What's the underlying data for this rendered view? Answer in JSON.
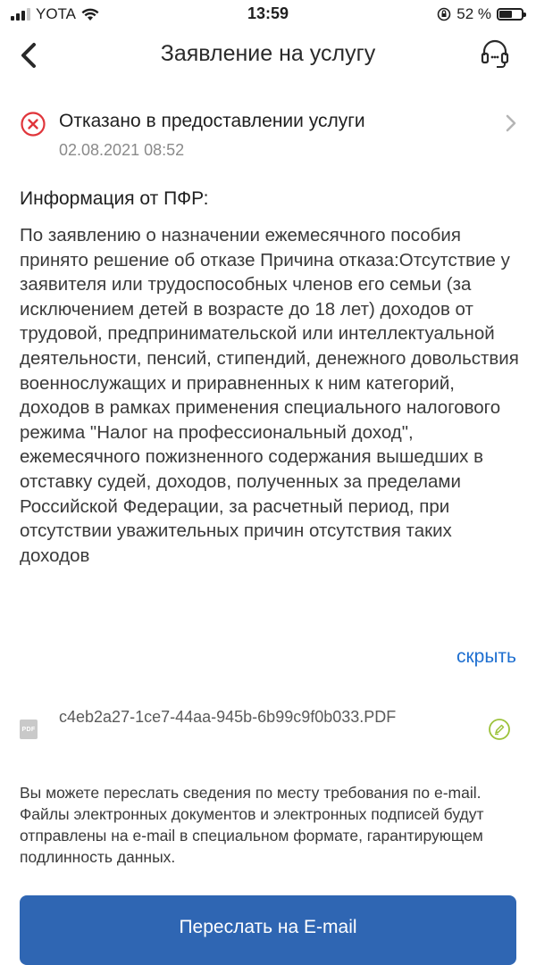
{
  "status_bar": {
    "carrier": "YOTA",
    "time": "13:59",
    "battery": "52 %",
    "battery_level": 0.52
  },
  "header": {
    "title": "Заявление на услугу",
    "back_icon": "chevron-left-icon",
    "support_icon": "headset-icon"
  },
  "status": {
    "text": "Отказано в предоставлении услуги",
    "date": "02.08.2021 08:52",
    "icon": "rejected-x-icon",
    "color": "#e0353b"
  },
  "info": {
    "title": "Информация от ПФР:",
    "body": "По заявлению о назначении ежемесячного пособия принято решение об отказе Причина отказа:Отсутствие у заявителя или трудоспособных членов его семьи (за исключением детей в возрасте до 18 лет) доходов от трудовой, предпринимательской или интеллектуальной деятельности, пенсий, стипендий, денежного довольствия военнослужащих и приравненных к ним категорий, доходов в рамках применения специального налогового режима \"Налог на профессиональный доход\", ежемесячного пожизненного содержания вышедших в отставку судей, доходов, полученных за пределами Российской Федерации, за расчетный период, при отсутствии уважительных причин отсутствия таких доходов",
    "hide_label": "скрыть"
  },
  "file": {
    "type_label": "PDF",
    "name": "c4eb2a27-1ce7-44aa-945b-6b99c9f0b033.PDF"
  },
  "forward": {
    "note": "Вы можете переслать сведения по месту требования по e-mail. Файлы электронных документов и электронных подписей будут отправлены на e-mail в специальном формате, гарантирующем  подлинность данных.",
    "button_label": "Переслать на E-mail"
  },
  "colors": {
    "accent": "#2f66b3",
    "link": "#1e6fd0",
    "error": "#e0353b",
    "signature": "#9cc23a"
  }
}
